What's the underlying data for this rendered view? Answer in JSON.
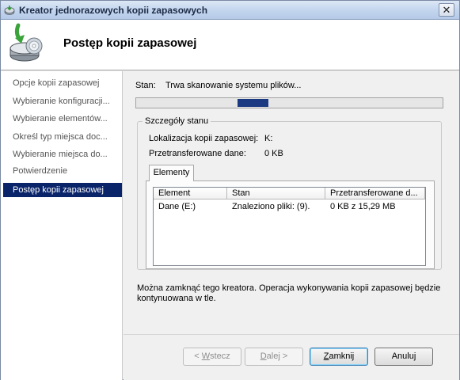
{
  "window": {
    "title": "Kreator jednorazowych kopii zapasowych",
    "close_glyph": "✕"
  },
  "header": {
    "title": "Postęp kopii zapasowej",
    "icon": "backup-drive-icon"
  },
  "sidebar": {
    "steps": [
      {
        "label": "Opcje kopii zapasowej",
        "active": false
      },
      {
        "label": "Wybieranie konfiguracji...",
        "active": false
      },
      {
        "label": "Wybieranie elementów...",
        "active": false
      },
      {
        "label": "Określ typ miejsca doc...",
        "active": false
      },
      {
        "label": "Wybieranie miejsca do...",
        "active": false
      },
      {
        "label": "Potwierdzenie",
        "active": false
      },
      {
        "label": "Postęp kopii zapasowej",
        "active": true
      }
    ]
  },
  "status": {
    "label": "Stan:",
    "value": "Trwa skanowanie systemu plików..."
  },
  "details": {
    "group_title": "Szczegóły stanu",
    "location_label": "Lokalizacja kopii zapasowej:",
    "location_value": "K:",
    "transferred_label": "Przetransferowane dane:",
    "transferred_value": "0 KB",
    "tab_label": "Elementy",
    "columns": [
      "Element",
      "Stan",
      "Przetransferowane d..."
    ],
    "rows": [
      {
        "element": "Dane (E:)",
        "state": "Znaleziono pliki: (9).",
        "transferred": "0 KB z 15,29 MB"
      }
    ]
  },
  "note": "Można zamknąć tego kreatora. Operacja wykonywania kopii zapasowej będzie kontynuowana w tle.",
  "buttons": {
    "back": {
      "prefix": "< ",
      "mnemonic": "W",
      "rest": "stecz"
    },
    "next": {
      "prefix": "",
      "mnemonic": "D",
      "rest": "alej >"
    },
    "close": {
      "prefix": "",
      "mnemonic": "Z",
      "rest": "amknij"
    },
    "cancel": {
      "label": "Anuluj"
    }
  },
  "colors": {
    "active_step_bg": "#0a246a",
    "progress_fill": "#1c3a82"
  }
}
